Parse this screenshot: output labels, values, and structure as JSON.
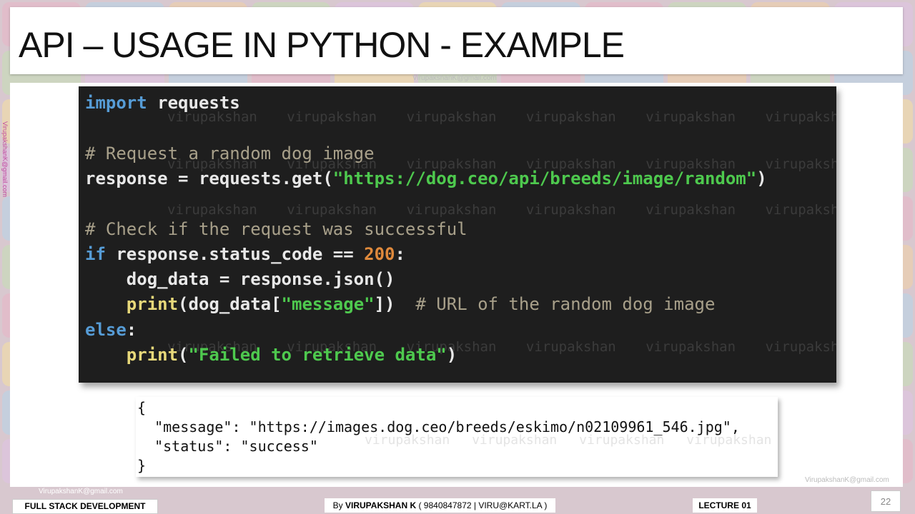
{
  "slide": {
    "title": "API – USAGE IN PYTHON - EXAMPLE",
    "page_number": "22"
  },
  "watermarks": {
    "email": "VirupakshanK@gmail.com",
    "code_word": "virupakshan"
  },
  "code_lines": {
    "l1_kw": "import",
    "l1_rest": " requests",
    "l2_comment": "# Request a random dog image",
    "l3_a": "response = requests.get(",
    "l3_str": "\"https://dog.ceo/api/breeds/image/random\"",
    "l3_b": ")",
    "l4_comment": "# Check if the request was successful",
    "l5_kw": "if",
    "l5_a": " response.status_code == ",
    "l5_num": "200",
    "l5_b": ":",
    "l6": "    dog_data = response.json()",
    "l7_indent": "    ",
    "l7_fn": "print",
    "l7_a": "(dog_data[",
    "l7_str": "\"message\"",
    "l7_b": "])  ",
    "l7_comment": "# URL of the random dog image",
    "l8_kw": "else",
    "l8_b": ":",
    "l9_indent": "    ",
    "l9_fn": "print",
    "l9_a": "(",
    "l9_str": "\"Failed to retrieve data\"",
    "l9_b": ")"
  },
  "json_output": {
    "open": "{",
    "message_line": "  \"message\": \"https://images.dog.ceo/breeds/eskimo/n02109961_546.jpg\",",
    "status_line": "  \"status\": \"success\"",
    "close": "}"
  },
  "footer": {
    "course": "FULL STACK DEVELOPMENT",
    "author_prefix": "By ",
    "author_name": "VIRUPAKSHAN K",
    "author_contact": " ( 9840847872 | VIRU@KART.LA )",
    "lecture": "LECTURE 01"
  }
}
